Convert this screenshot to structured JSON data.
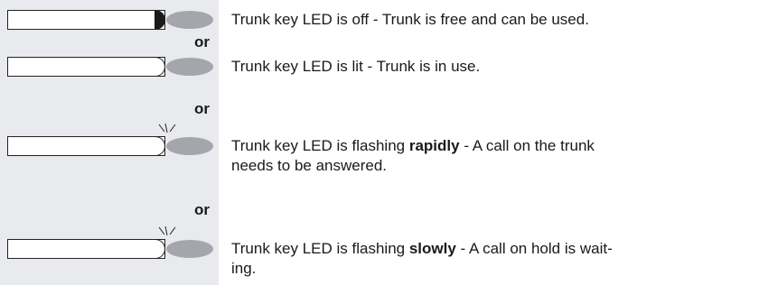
{
  "rows": [
    {
      "state": "off",
      "text": "Trunk key LED is off - Trunk is free and can be used."
    },
    {
      "state": "lit",
      "text": "Trunk key LED is lit - Trunk is in use."
    },
    {
      "state": "flashing-rapid",
      "text_pre": "Trunk key LED is flashing ",
      "text_bold": "rapidly",
      "text_post": " - A call on the trunk",
      "text_line2": "needs to be answered."
    },
    {
      "state": "flashing-slow",
      "text_pre": "Trunk key LED is flashing ",
      "text_bold": "slowly",
      "text_post": " - A call on hold is wait-",
      "text_line2": "ing."
    }
  ],
  "separators": [
    "or",
    "or",
    "or"
  ],
  "colors": {
    "sidebar": "#e9eaee",
    "led": "#a5a6ab",
    "key_border": "#222222"
  }
}
